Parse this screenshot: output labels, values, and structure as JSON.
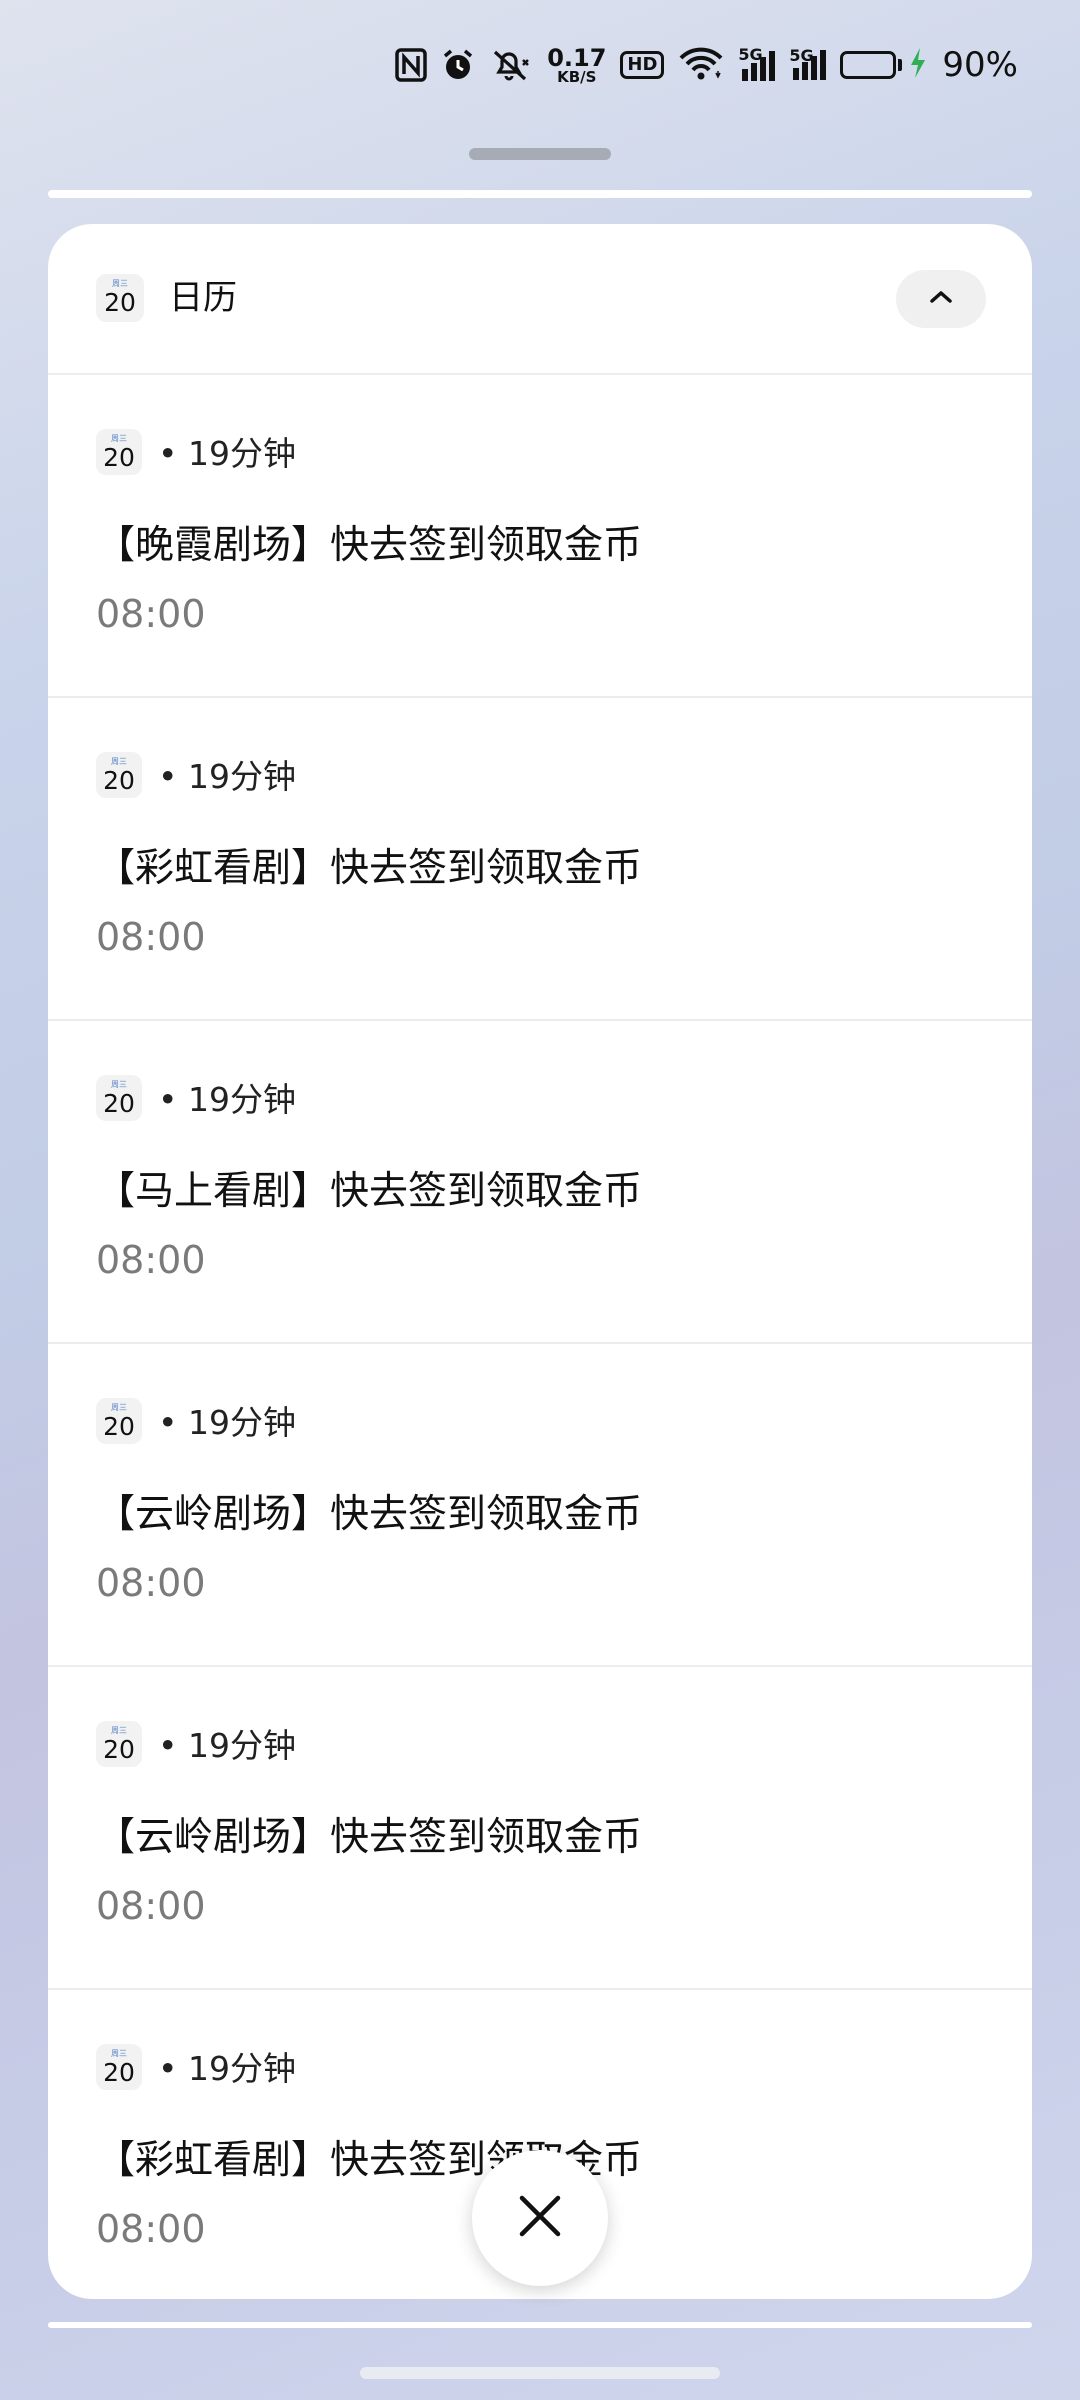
{
  "status_bar": {
    "speed_value": "0.17",
    "speed_unit": "KB/S",
    "hd_label": "HD",
    "sim1_label": "5G",
    "sim2_label": "5G",
    "battery_percent": "90%",
    "battery_level": 0.9,
    "battery_color": "#2fae54",
    "icons": [
      "nfc-icon",
      "alarm-icon",
      "mute-icon",
      "hd-icon",
      "wifi-icon",
      "signal-icon",
      "battery-icon",
      "charging-icon"
    ]
  },
  "card": {
    "app_icon_weekday": "周三",
    "app_icon_day": "20",
    "app_name": "日历",
    "collapse_icon": "chevron-up-icon"
  },
  "notifications": [
    {
      "icon_weekday": "周三",
      "icon_day": "20",
      "meta": "• 19分钟",
      "title": "【晚霞剧场】快去签到领取金币",
      "time": "08:00"
    },
    {
      "icon_weekday": "周三",
      "icon_day": "20",
      "meta": "• 19分钟",
      "title": "【彩虹看剧】快去签到领取金币",
      "time": "08:00"
    },
    {
      "icon_weekday": "周三",
      "icon_day": "20",
      "meta": "• 19分钟",
      "title": "【马上看剧】快去签到领取金币",
      "time": "08:00"
    },
    {
      "icon_weekday": "周三",
      "icon_day": "20",
      "meta": "• 19分钟",
      "title": "【云岭剧场】快去签到领取金币",
      "time": "08:00"
    },
    {
      "icon_weekday": "周三",
      "icon_day": "20",
      "meta": "• 19分钟",
      "title": "【云岭剧场】快去签到领取金币",
      "time": "08:00"
    },
    {
      "icon_weekday": "周三",
      "icon_day": "20",
      "meta": "• 19分钟",
      "title": "【彩虹看剧】快去签到领取金币",
      "time": "08:00"
    }
  ],
  "close_button": {
    "icon": "close-icon"
  }
}
